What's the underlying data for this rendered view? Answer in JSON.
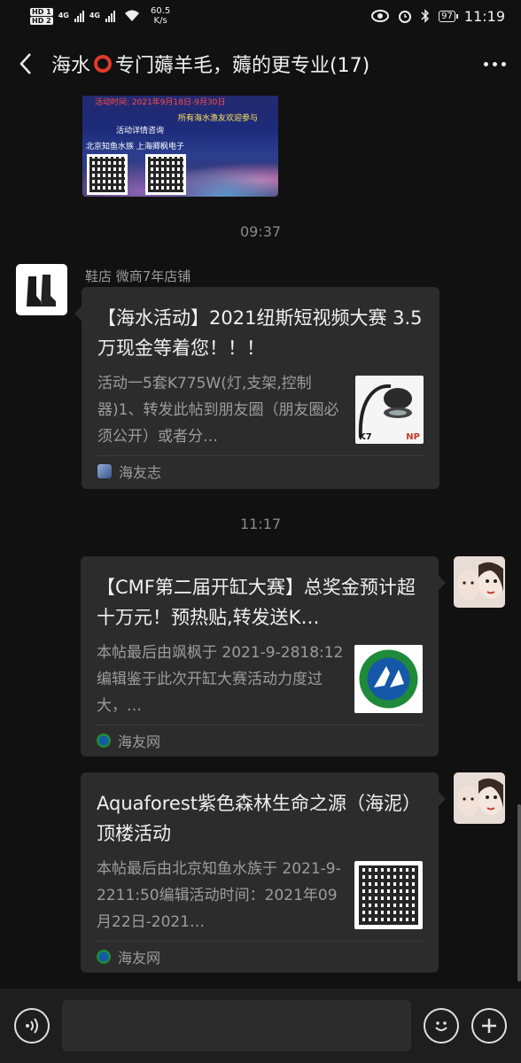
{
  "status_bar": {
    "hd1": "HD 1",
    "hd2": "HD 2",
    "net1": "4G",
    "net2": "4G",
    "speed_value": "60.5",
    "speed_unit": "K/s",
    "battery": "97",
    "time": "11:19"
  },
  "header": {
    "title_part1": "海水",
    "title_part2": "专门薅羊毛，薅的更专业(17)",
    "title_trail": "",
    "back_icon": "chevron-left-icon",
    "more_icon": "more-dots-icon"
  },
  "poster": {
    "line1": "活动时间: 2021年9月18日-9月30日",
    "line2": "所有海水渔友欢迎参与",
    "line3": "活动详情咨询",
    "line4": "北京知鱼水族  上海卿枫电子"
  },
  "messages": [
    {
      "timestamp": "09:37",
      "sender": "鞋店  微商7年店铺",
      "card": {
        "title": "【海水活动】2021纽斯短视频大赛 3.5万现金等着您！！！",
        "desc": "活动一5套K775W(灯,支架,控制器)1、转发此帖到朋友圈（朋友圈必须公开）或者分…",
        "source": "海友志",
        "thumb_label1": "K7",
        "thumb_label2": "NP"
      }
    },
    {
      "timestamp": "11:17",
      "card": {
        "title": "【CMF第二届开缸大赛】总奖金预计超十万元！预热贴,转发送K…",
        "desc": "本帖最后由飒枫于 2021-9-2818:12编辑鉴于此次开缸大赛活动力度过大，…",
        "source": "海友网"
      }
    },
    {
      "card": {
        "title": "Aquaforest紫色森林生命之源（海泥）顶楼活动",
        "desc": "本帖最后由北京知鱼水族于 2021-9-2211:50编辑活动时间：2021年09月22日-2021…",
        "source": "海友网"
      }
    }
  ],
  "bottom_bar": {
    "voice_icon": "voice-icon",
    "emoji_icon": "emoji-icon",
    "plus_icon": "plus-icon",
    "input_value": ""
  },
  "colors": {
    "background": "#111111",
    "card": "#2c2c2c",
    "accent_red": "#e23a2a",
    "muted_text": "#9c9c9c"
  }
}
